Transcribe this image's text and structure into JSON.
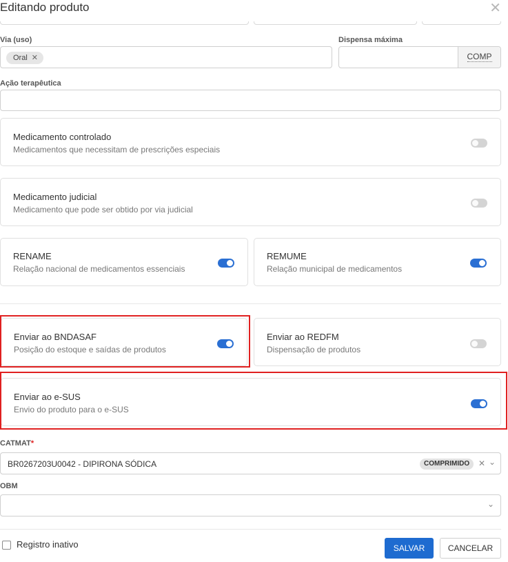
{
  "dialog": {
    "title": "Editando produto"
  },
  "via": {
    "label": "Via (uso)",
    "tags": [
      "Oral"
    ]
  },
  "dispensa": {
    "label": "Dispensa máxima",
    "value": "",
    "unit": "COMP"
  },
  "acao": {
    "label": "Ação terapêutica",
    "value": ""
  },
  "cards": {
    "controlado": {
      "title": "Medicamento controlado",
      "desc": "Medicamentos que necessitam de prescrições especiais",
      "on": false
    },
    "judicial": {
      "title": "Medicamento judicial",
      "desc": "Medicamento que pode ser obtido por via judicial",
      "on": false
    },
    "rename": {
      "title": "RENAME",
      "desc": "Relação nacional de medicamentos essenciais",
      "on": true
    },
    "remume": {
      "title": "REMUME",
      "desc": "Relação municipal de medicamentos",
      "on": true
    },
    "bndasaf": {
      "title": "Enviar ao BNDASAF",
      "desc": "Posição do estoque e saídas de produtos",
      "on": true
    },
    "redfm": {
      "title": "Enviar ao REDFM",
      "desc": "Dispensação de produtos",
      "on": false
    },
    "esus": {
      "title": "Enviar ao e-SUS",
      "desc": "Envio do produto para o e-SUS",
      "on": true
    }
  },
  "catmat": {
    "label": "CATMAT",
    "required_mark": "*",
    "value": "BR0267203U0042 - DIPIRONA SÓDICA",
    "badge": "COMPRIMIDO"
  },
  "obm": {
    "label": "OBM",
    "value": ""
  },
  "footer": {
    "checkbox_label": "Registro inativo",
    "checked": false,
    "save_label": "SALVAR",
    "cancel_label": "CANCELAR"
  },
  "colors": {
    "accent": "#1e6bd0",
    "toggle_on": "#2a6fd3",
    "highlight": "#e02020"
  },
  "icons": {
    "close": "close-icon",
    "tag_remove": "x-icon",
    "clear": "clear-icon",
    "dropdown": "chevron-down-icon"
  }
}
